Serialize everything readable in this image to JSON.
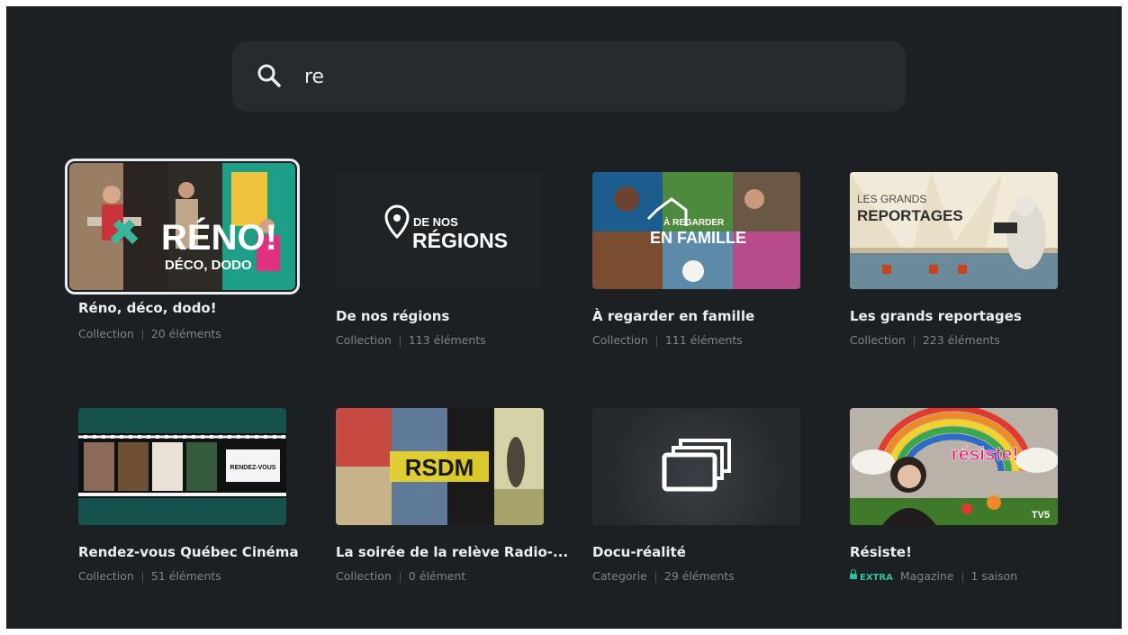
{
  "search": {
    "query": "re"
  },
  "cards": [
    {
      "title": "Réno, déco, dodo!",
      "type": "Collection",
      "count": "20 éléments",
      "thumb_text": {
        "main": "RÉNO!",
        "sub": "DÉCO, DODO"
      }
    },
    {
      "title": "De nos régions",
      "type": "Collection",
      "count": "113 éléments",
      "thumb_text": {
        "small": "DE NOS",
        "main": "RÉGIONS"
      }
    },
    {
      "title": "À regarder en famille",
      "type": "Collection",
      "count": "111 éléments",
      "thumb_text": {
        "small": "À REGARDER",
        "main": "EN FAMILLE"
      }
    },
    {
      "title": "Les grands reportages",
      "type": "Collection",
      "count": "223 éléments",
      "thumb_text": {
        "small": "LES GRANDS",
        "main": "REPORTAGES"
      }
    },
    {
      "title": "Rendez-vous Québec Cinéma",
      "type": "Collection",
      "count": "51 éléments",
      "thumb_text": {
        "main": "RENDEZ-VOUS"
      }
    },
    {
      "title": "La soirée de la relève Radio-...",
      "type": "Collection",
      "count": "0 élément",
      "thumb_text": {
        "main": "RSDM"
      }
    },
    {
      "title": "Docu-réalité",
      "type": "Categorie",
      "count": "29 éléments"
    },
    {
      "title": "Résiste!",
      "badge": "EXTRA",
      "type": "Magazine",
      "count": "1 saison",
      "thumb_text": {
        "main": "résiste!",
        "logo": "TV5"
      }
    }
  ],
  "colors": {
    "background": "#1c2023",
    "search_bg": "#272b2f",
    "text": "#eceff1",
    "meta": "#7c858b",
    "extra": "#2fc2a0"
  },
  "icons": {
    "search": "search-icon",
    "collection": "stacked-cards-icon",
    "pin": "location-pin-icon",
    "lock": "lock-icon"
  }
}
